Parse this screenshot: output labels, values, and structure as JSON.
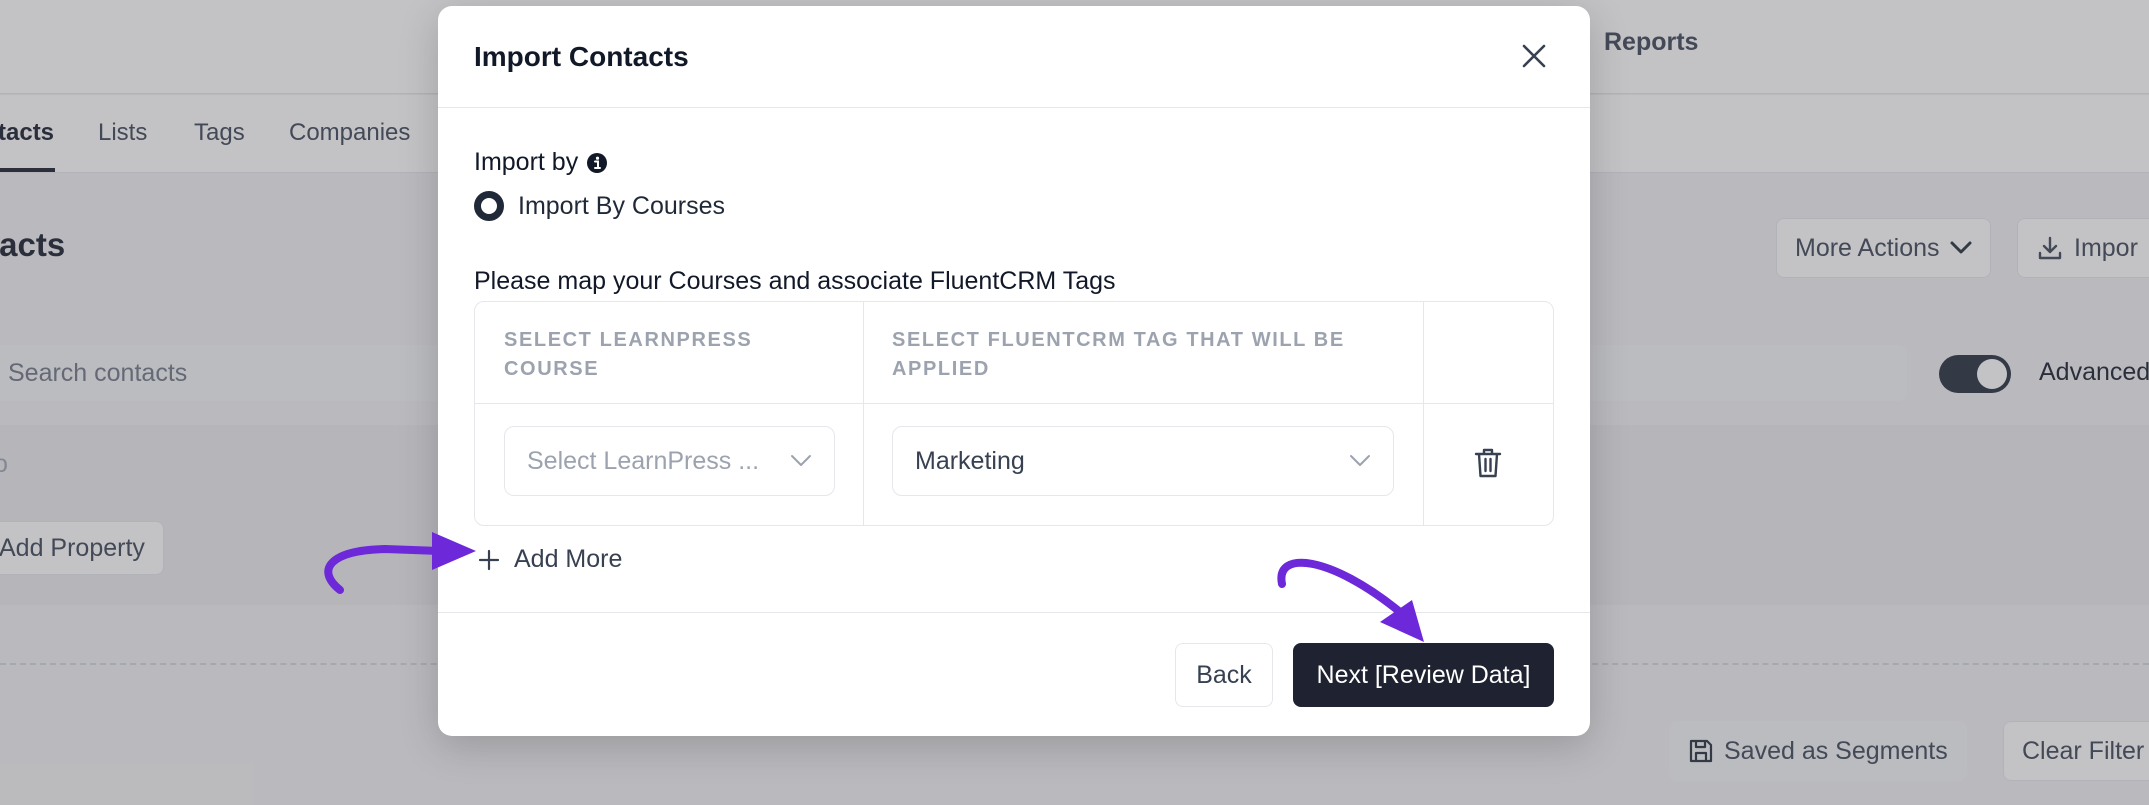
{
  "background": {
    "top_nav": {
      "reports": "Reports"
    },
    "sub_nav": {
      "tabs": [
        "tacts",
        "Lists",
        "Tags",
        "Companies"
      ]
    },
    "page_title": "ntacts",
    "actions": {
      "more_actions": "More Actions",
      "import": "Impor"
    },
    "search": {
      "placeholder": "Search contacts"
    },
    "advanced_label": "Advanced",
    "or_label": "o",
    "add_property": "Add Property",
    "saved_segments": "Saved as Segments",
    "clear_filters": "Clear Filter"
  },
  "modal": {
    "title": "Import Contacts",
    "import_by_label": "Import by",
    "radio_option": "Import By Courses",
    "mapping_label": "Please map your Courses and associate FluentCRM Tags",
    "table": {
      "headers": [
        "SELECT LEARNPRESS COURSE",
        "SELECT FLUENTCRM TAG THAT WILL BE APPLIED"
      ],
      "rows": [
        {
          "course_placeholder": "Select LearnPress ...",
          "tag_value": "Marketing"
        }
      ]
    },
    "add_more": "Add More",
    "buttons": {
      "back": "Back",
      "next": "Next [Review Data]"
    }
  },
  "colors": {
    "primary_button": "#1f2230",
    "annotation_arrow": "#6d28d9",
    "overlay": "rgba(90,90,96,0.36)"
  },
  "icons": [
    "close-icon",
    "info-icon",
    "chevron-down-icon",
    "trash-icon",
    "plus-icon",
    "download-icon",
    "save-icon"
  ]
}
